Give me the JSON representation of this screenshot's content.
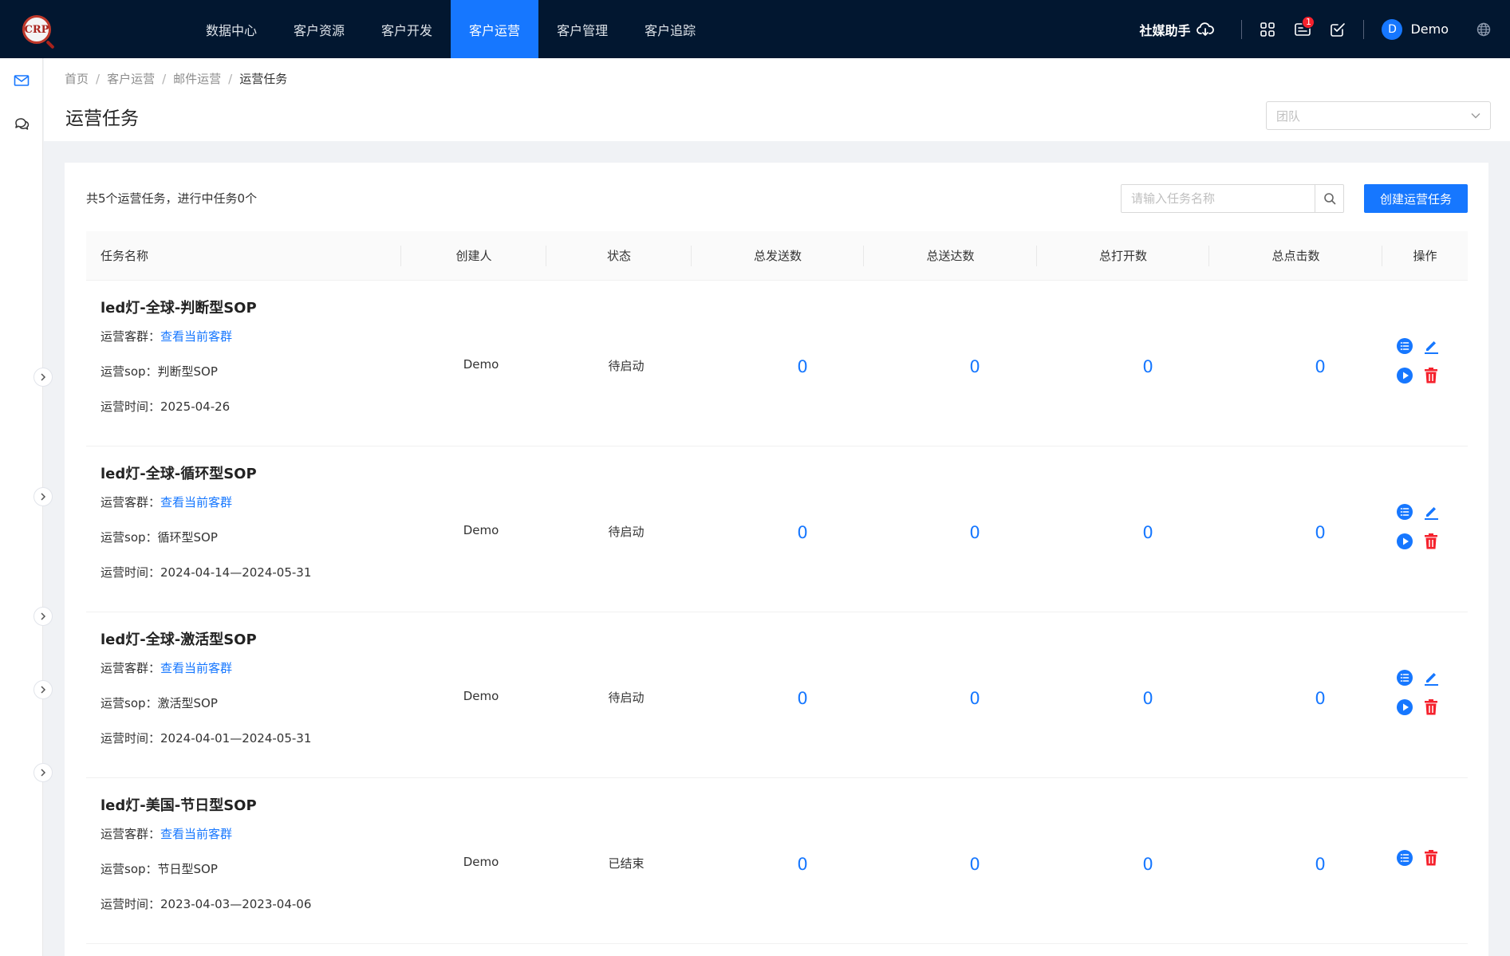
{
  "nav": {
    "items": [
      "数据中心",
      "客户资源",
      "客户开发",
      "客户运营",
      "客户管理",
      "客户追踪"
    ],
    "active_index": 3
  },
  "header": {
    "helper_label": "社媒助手",
    "notification_count": "1",
    "avatar_letter": "D",
    "username": "Demo"
  },
  "breadcrumb": [
    "首页",
    "客户运营",
    "邮件运营",
    "运营任务"
  ],
  "page": {
    "title": "运营任务",
    "team_placeholder": "团队"
  },
  "toolbar": {
    "summary": "共5个运营任务，进行中任务0个",
    "search_placeholder": "请输入任务名称",
    "create_label": "创建运营任务"
  },
  "table": {
    "headers": [
      "任务名称",
      "创建人",
      "状态",
      "总发送数",
      "总送达数",
      "总打开数",
      "总点击数",
      "操作"
    ],
    "meta_labels": {
      "group": "运营客群：",
      "group_link": "查看当前客群",
      "sop": "运营sop：",
      "time": "运营时间："
    },
    "rows": [
      {
        "name": "led灯-全球-判断型SOP",
        "sop": "判断型SOP",
        "time": "2025-04-26",
        "creator": "Demo",
        "status": "待启动",
        "sent": "0",
        "delivered": "0",
        "opened": "0",
        "clicked": "0"
      },
      {
        "name": "led灯-全球-循环型SOP",
        "sop": "循环型SOP",
        "time": "2024-04-14—2024-05-31",
        "creator": "Demo",
        "status": "待启动",
        "sent": "0",
        "delivered": "0",
        "opened": "0",
        "clicked": "0"
      },
      {
        "name": "led灯-全球-激活型SOP",
        "sop": "激活型SOP",
        "time": "2024-04-01—2024-05-31",
        "creator": "Demo",
        "status": "待启动",
        "sent": "0",
        "delivered": "0",
        "opened": "0",
        "clicked": "0"
      },
      {
        "name": "led灯-美国-节日型SOP",
        "sop": "节日型SOP",
        "time": "2023-04-03—2023-04-06",
        "creator": "Demo",
        "status": "已结束",
        "sent": "0",
        "delivered": "0",
        "opened": "0",
        "clicked": "0"
      }
    ]
  },
  "colors": {
    "topbar": "#021730",
    "primary": "#1677ff",
    "danger": "#f5222d"
  }
}
